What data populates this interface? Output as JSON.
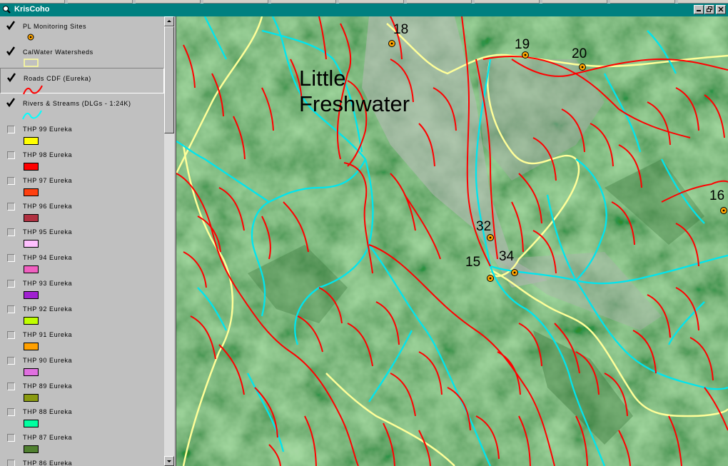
{
  "window": {
    "title": "KrisCoho"
  },
  "layers": [
    {
      "name": "PL Monitoring Sites",
      "checked": true,
      "symbol": "site-point"
    },
    {
      "name": "CalWater Watersheds",
      "checked": true,
      "symbol": "polygon-outline",
      "color": "#ffff99"
    },
    {
      "name": "Roads CDF (Eureka)",
      "checked": true,
      "symbol": "line",
      "color": "#ff0000",
      "selected": true
    },
    {
      "name": "Rivers & Streams (DLGs - 1:24K)",
      "checked": true,
      "symbol": "line",
      "color": "#00ffff"
    },
    {
      "name": "THP 99 Eureka",
      "checked": false,
      "color": "#ffff00"
    },
    {
      "name": "THP 98 Eureka",
      "checked": false,
      "color": "#ff0000"
    },
    {
      "name": "THP 97 Eureka",
      "checked": false,
      "color": "#ff4010"
    },
    {
      "name": "THP 96 Eureka",
      "checked": false,
      "color": "#b03040"
    },
    {
      "name": "THP 95 Eureka",
      "checked": false,
      "color": "#ffc0ff"
    },
    {
      "name": "THP 94 Eureka",
      "checked": false,
      "color": "#f060c0"
    },
    {
      "name": "THP 93 Eureka",
      "checked": false,
      "color": "#a020d0"
    },
    {
      "name": "THP 92 Eureka",
      "checked": false,
      "color": "#c0ff00"
    },
    {
      "name": "THP 91 Eureka",
      "checked": false,
      "color": "#ffa000"
    },
    {
      "name": "THP 90 Eureka",
      "checked": false,
      "color": "#e070e0"
    },
    {
      "name": "THP 89 Eureka",
      "checked": false,
      "color": "#8a9a10"
    },
    {
      "name": "THP 88 Eureka",
      "checked": false,
      "color": "#00ffa0"
    },
    {
      "name": "THP 87 Eureka",
      "checked": false,
      "color": "#508030"
    },
    {
      "name": "THP 86 Eureka",
      "checked": false,
      "color": "#60c060"
    }
  ],
  "map": {
    "place_label": [
      "Little",
      "Freshwater"
    ],
    "sites": [
      {
        "label": "18"
      },
      {
        "label": "19"
      },
      {
        "label": "20"
      },
      {
        "label": "16"
      },
      {
        "label": "32"
      },
      {
        "label": "15"
      },
      {
        "label": "34"
      }
    ],
    "colors": {
      "terrain": "#6aa86a",
      "roads": "#ff0000",
      "streams": "#00e5ee",
      "watershed": "#ffff99",
      "site": "#ffa500"
    }
  }
}
